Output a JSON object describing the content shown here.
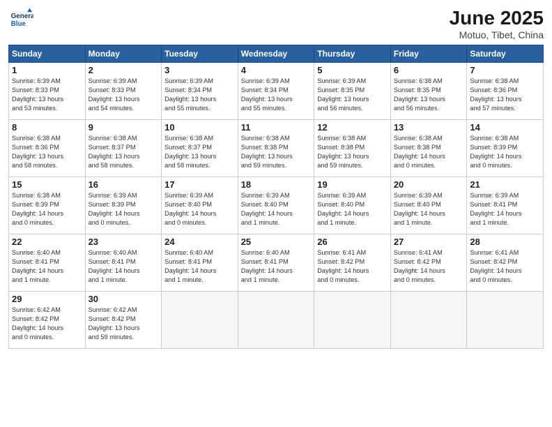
{
  "header": {
    "logo_line1": "General",
    "logo_line2": "Blue",
    "month": "June 2025",
    "location": "Motuo, Tibet, China"
  },
  "weekdays": [
    "Sunday",
    "Monday",
    "Tuesday",
    "Wednesday",
    "Thursday",
    "Friday",
    "Saturday"
  ],
  "weeks": [
    [
      {
        "day": "1",
        "info": "Sunrise: 6:39 AM\nSunset: 8:33 PM\nDaylight: 13 hours\nand 53 minutes."
      },
      {
        "day": "2",
        "info": "Sunrise: 6:39 AM\nSunset: 8:33 PM\nDaylight: 13 hours\nand 54 minutes."
      },
      {
        "day": "3",
        "info": "Sunrise: 6:39 AM\nSunset: 8:34 PM\nDaylight: 13 hours\nand 55 minutes."
      },
      {
        "day": "4",
        "info": "Sunrise: 6:39 AM\nSunset: 8:34 PM\nDaylight: 13 hours\nand 55 minutes."
      },
      {
        "day": "5",
        "info": "Sunrise: 6:39 AM\nSunset: 8:35 PM\nDaylight: 13 hours\nand 56 minutes."
      },
      {
        "day": "6",
        "info": "Sunrise: 6:38 AM\nSunset: 8:35 PM\nDaylight: 13 hours\nand 56 minutes."
      },
      {
        "day": "7",
        "info": "Sunrise: 6:38 AM\nSunset: 8:36 PM\nDaylight: 13 hours\nand 57 minutes."
      }
    ],
    [
      {
        "day": "8",
        "info": "Sunrise: 6:38 AM\nSunset: 8:36 PM\nDaylight: 13 hours\nand 58 minutes."
      },
      {
        "day": "9",
        "info": "Sunrise: 6:38 AM\nSunset: 8:37 PM\nDaylight: 13 hours\nand 58 minutes."
      },
      {
        "day": "10",
        "info": "Sunrise: 6:38 AM\nSunset: 8:37 PM\nDaylight: 13 hours\nand 58 minutes."
      },
      {
        "day": "11",
        "info": "Sunrise: 6:38 AM\nSunset: 8:38 PM\nDaylight: 13 hours\nand 59 minutes."
      },
      {
        "day": "12",
        "info": "Sunrise: 6:38 AM\nSunset: 8:38 PM\nDaylight: 13 hours\nand 59 minutes."
      },
      {
        "day": "13",
        "info": "Sunrise: 6:38 AM\nSunset: 8:38 PM\nDaylight: 14 hours\nand 0 minutes."
      },
      {
        "day": "14",
        "info": "Sunrise: 6:38 AM\nSunset: 8:39 PM\nDaylight: 14 hours\nand 0 minutes."
      }
    ],
    [
      {
        "day": "15",
        "info": "Sunrise: 6:38 AM\nSunset: 8:39 PM\nDaylight: 14 hours\nand 0 minutes."
      },
      {
        "day": "16",
        "info": "Sunrise: 6:39 AM\nSunset: 8:39 PM\nDaylight: 14 hours\nand 0 minutes."
      },
      {
        "day": "17",
        "info": "Sunrise: 6:39 AM\nSunset: 8:40 PM\nDaylight: 14 hours\nand 0 minutes."
      },
      {
        "day": "18",
        "info": "Sunrise: 6:39 AM\nSunset: 8:40 PM\nDaylight: 14 hours\nand 1 minute."
      },
      {
        "day": "19",
        "info": "Sunrise: 6:39 AM\nSunset: 8:40 PM\nDaylight: 14 hours\nand 1 minute."
      },
      {
        "day": "20",
        "info": "Sunrise: 6:39 AM\nSunset: 8:40 PM\nDaylight: 14 hours\nand 1 minute."
      },
      {
        "day": "21",
        "info": "Sunrise: 6:39 AM\nSunset: 8:41 PM\nDaylight: 14 hours\nand 1 minute."
      }
    ],
    [
      {
        "day": "22",
        "info": "Sunrise: 6:40 AM\nSunset: 8:41 PM\nDaylight: 14 hours\nand 1 minute."
      },
      {
        "day": "23",
        "info": "Sunrise: 6:40 AM\nSunset: 8:41 PM\nDaylight: 14 hours\nand 1 minute."
      },
      {
        "day": "24",
        "info": "Sunrise: 6:40 AM\nSunset: 8:41 PM\nDaylight: 14 hours\nand 1 minute."
      },
      {
        "day": "25",
        "info": "Sunrise: 6:40 AM\nSunset: 8:41 PM\nDaylight: 14 hours\nand 1 minute."
      },
      {
        "day": "26",
        "info": "Sunrise: 6:41 AM\nSunset: 8:42 PM\nDaylight: 14 hours\nand 0 minutes."
      },
      {
        "day": "27",
        "info": "Sunrise: 6:41 AM\nSunset: 8:42 PM\nDaylight: 14 hours\nand 0 minutes."
      },
      {
        "day": "28",
        "info": "Sunrise: 6:41 AM\nSunset: 8:42 PM\nDaylight: 14 hours\nand 0 minutes."
      }
    ],
    [
      {
        "day": "29",
        "info": "Sunrise: 6:42 AM\nSunset: 8:42 PM\nDaylight: 14 hours\nand 0 minutes."
      },
      {
        "day": "30",
        "info": "Sunrise: 6:42 AM\nSunset: 8:42 PM\nDaylight: 13 hours\nand 59 minutes."
      },
      {
        "day": "",
        "info": ""
      },
      {
        "day": "",
        "info": ""
      },
      {
        "day": "",
        "info": ""
      },
      {
        "day": "",
        "info": ""
      },
      {
        "day": "",
        "info": ""
      }
    ]
  ]
}
